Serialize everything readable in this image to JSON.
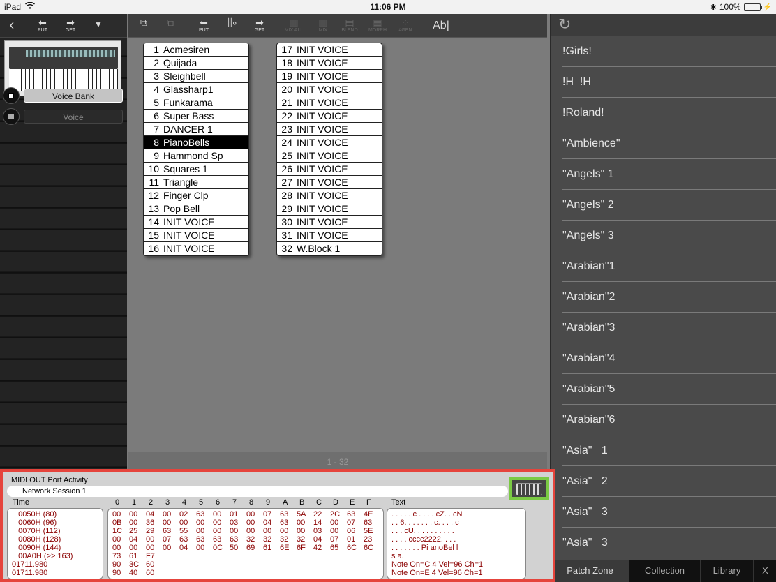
{
  "status_bar": {
    "device": "iPad",
    "time": "11:06 PM",
    "battery": "100%"
  },
  "side_toolbar": {
    "back_icon": "chevron-left-icon",
    "put_label": "PUT",
    "get_label": "GET",
    "menu_icon": "triangle-down-icon"
  },
  "sidebar": {
    "items": [
      {
        "label": "Voice Bank",
        "selected": true
      },
      {
        "label": "Voice",
        "selected": false
      }
    ]
  },
  "main_toolbar": {
    "buttons": [
      {
        "icon": "copy-icon",
        "label": ""
      },
      {
        "icon": "paste-icon",
        "label": ""
      },
      {
        "icon": "put-arrow-icon",
        "label": "PUT"
      },
      {
        "icon": "sliders-icon",
        "label": ""
      },
      {
        "icon": "get-arrow-icon",
        "label": "GET"
      },
      {
        "icon": "mix-all-icon",
        "label": "MIX ALL"
      },
      {
        "icon": "mix-icon",
        "label": "MIX"
      },
      {
        "icon": "blend-icon",
        "label": "BLEND"
      },
      {
        "icon": "morph-icon",
        "label": "MORPH"
      },
      {
        "icon": "gen-icon",
        "label": "#GEN"
      }
    ],
    "text_tool": "Ab|"
  },
  "voices_left": [
    {
      "num": "1",
      "name": "Acmesiren"
    },
    {
      "num": "2",
      "name": "Quijada"
    },
    {
      "num": "3",
      "name": "Sleighbell"
    },
    {
      "num": "4",
      "name": "Glassharp1"
    },
    {
      "num": "5",
      "name": "Funkarama"
    },
    {
      "num": "6",
      "name": "Super Bass"
    },
    {
      "num": "7",
      "name": "DANCER 1"
    },
    {
      "num": "8",
      "name": "PianoBells",
      "selected": true
    },
    {
      "num": "9",
      "name": "Hammond Sp"
    },
    {
      "num": "10",
      "name": "Squares 1"
    },
    {
      "num": "11",
      "name": "Triangle"
    },
    {
      "num": "12",
      "name": "Finger Clp"
    },
    {
      "num": "13",
      "name": "Pop Bell"
    },
    {
      "num": "14",
      "name": "INIT VOICE"
    },
    {
      "num": "15",
      "name": "INIT VOICE"
    },
    {
      "num": "16",
      "name": "INIT VOICE"
    }
  ],
  "voices_right": [
    {
      "num": "17",
      "name": "INIT VOICE"
    },
    {
      "num": "18",
      "name": "INIT VOICE"
    },
    {
      "num": "19",
      "name": "INIT VOICE"
    },
    {
      "num": "20",
      "name": "INIT VOICE"
    },
    {
      "num": "21",
      "name": "INIT VOICE"
    },
    {
      "num": "22",
      "name": "INIT VOICE"
    },
    {
      "num": "23",
      "name": "INIT VOICE"
    },
    {
      "num": "24",
      "name": "INIT VOICE"
    },
    {
      "num": "25",
      "name": "INIT VOICE"
    },
    {
      "num": "26",
      "name": "INIT VOICE"
    },
    {
      "num": "27",
      "name": "INIT VOICE"
    },
    {
      "num": "28",
      "name": "INIT VOICE"
    },
    {
      "num": "29",
      "name": "INIT VOICE"
    },
    {
      "num": "30",
      "name": "INIT VOICE"
    },
    {
      "num": "31",
      "name": "INIT VOICE"
    },
    {
      "num": "32",
      "name": "W.Block 1"
    }
  ],
  "main_footer": {
    "range": "1 - 32"
  },
  "right_panel": {
    "refresh_icon": "refresh-icon",
    "patches": [
      "!Girls!",
      "!H  !H",
      "!Roland!",
      "\"Ambience\"",
      "\"Angels\" 1",
      "\"Angels\" 2",
      "\"Angels\" 3",
      "\"Arabian\"1",
      "\"Arabian\"2",
      "\"Arabian\"3",
      "\"Arabian\"4",
      "\"Arabian\"5",
      "\"Arabian\"6",
      "\"Asia\"   1",
      "\"Asia\"   2",
      "\"Asia\"   3",
      "\"Asia\"   3"
    ],
    "tabs": [
      {
        "label": "Patch Zone",
        "active": true
      },
      {
        "label": "Collection",
        "active": false
      },
      {
        "label": "Library",
        "active": false
      },
      {
        "label": "X",
        "active": false
      }
    ]
  },
  "midi": {
    "title": "MIDI OUT Port Activity",
    "port": "Network Session 1",
    "keyboard_icon": "keyboard-icon",
    "time_label": "Time",
    "text_label": "Text",
    "hex_columns": [
      "0",
      "1",
      "2",
      "3",
      "4",
      "5",
      "6",
      "7",
      "8",
      "9",
      "A",
      "B",
      "C",
      "D",
      "E",
      "F"
    ],
    "time_rows": [
      "   0050H (80)",
      "   0060H (96)",
      "   0070H (112)",
      "   0080H (128)",
      "   0090H (144)",
      "   00A0H (>> 163)",
      "01711.980",
      "01711.980"
    ],
    "hex_rows": [
      [
        "00",
        "00",
        "04",
        "00",
        "02",
        "63",
        "00",
        "01",
        "00",
        "07",
        "63",
        "5A",
        "22",
        "2C",
        "63",
        "4E"
      ],
      [
        "0B",
        "00",
        "36",
        "00",
        "00",
        "00",
        "00",
        "03",
        "00",
        "04",
        "63",
        "00",
        "14",
        "00",
        "07",
        "63"
      ],
      [
        "1C",
        "25",
        "29",
        "63",
        "55",
        "00",
        "00",
        "00",
        "00",
        "00",
        "00",
        "00",
        "03",
        "00",
        "06",
        "5E"
      ],
      [
        "00",
        "04",
        "00",
        "07",
        "63",
        "63",
        "63",
        "63",
        "32",
        "32",
        "32",
        "32",
        "04",
        "07",
        "01",
        "23"
      ],
      [
        "00",
        "00",
        "00",
        "00",
        "04",
        "00",
        "0C",
        "50",
        "69",
        "61",
        "6E",
        "6F",
        "42",
        "65",
        "6C",
        "6C"
      ],
      [
        "73",
        "61",
        "F7"
      ],
      [
        "90",
        "3C",
        "60"
      ],
      [
        "90",
        "40",
        "60"
      ]
    ],
    "text_rows": [
      ". . . . . c . . . . cZ. . cN",
      ". . 6. . . . . . . c. . . . c",
      ". . . cU. . . . . . . . . .",
      ". . . . cccc2222. . . .",
      ". . . . . . . Pi anoBel l",
      "s a.",
      "Note On=C 4 Vel=96 Ch=1",
      "Note On=E 4 Vel=96 Ch=1"
    ]
  }
}
